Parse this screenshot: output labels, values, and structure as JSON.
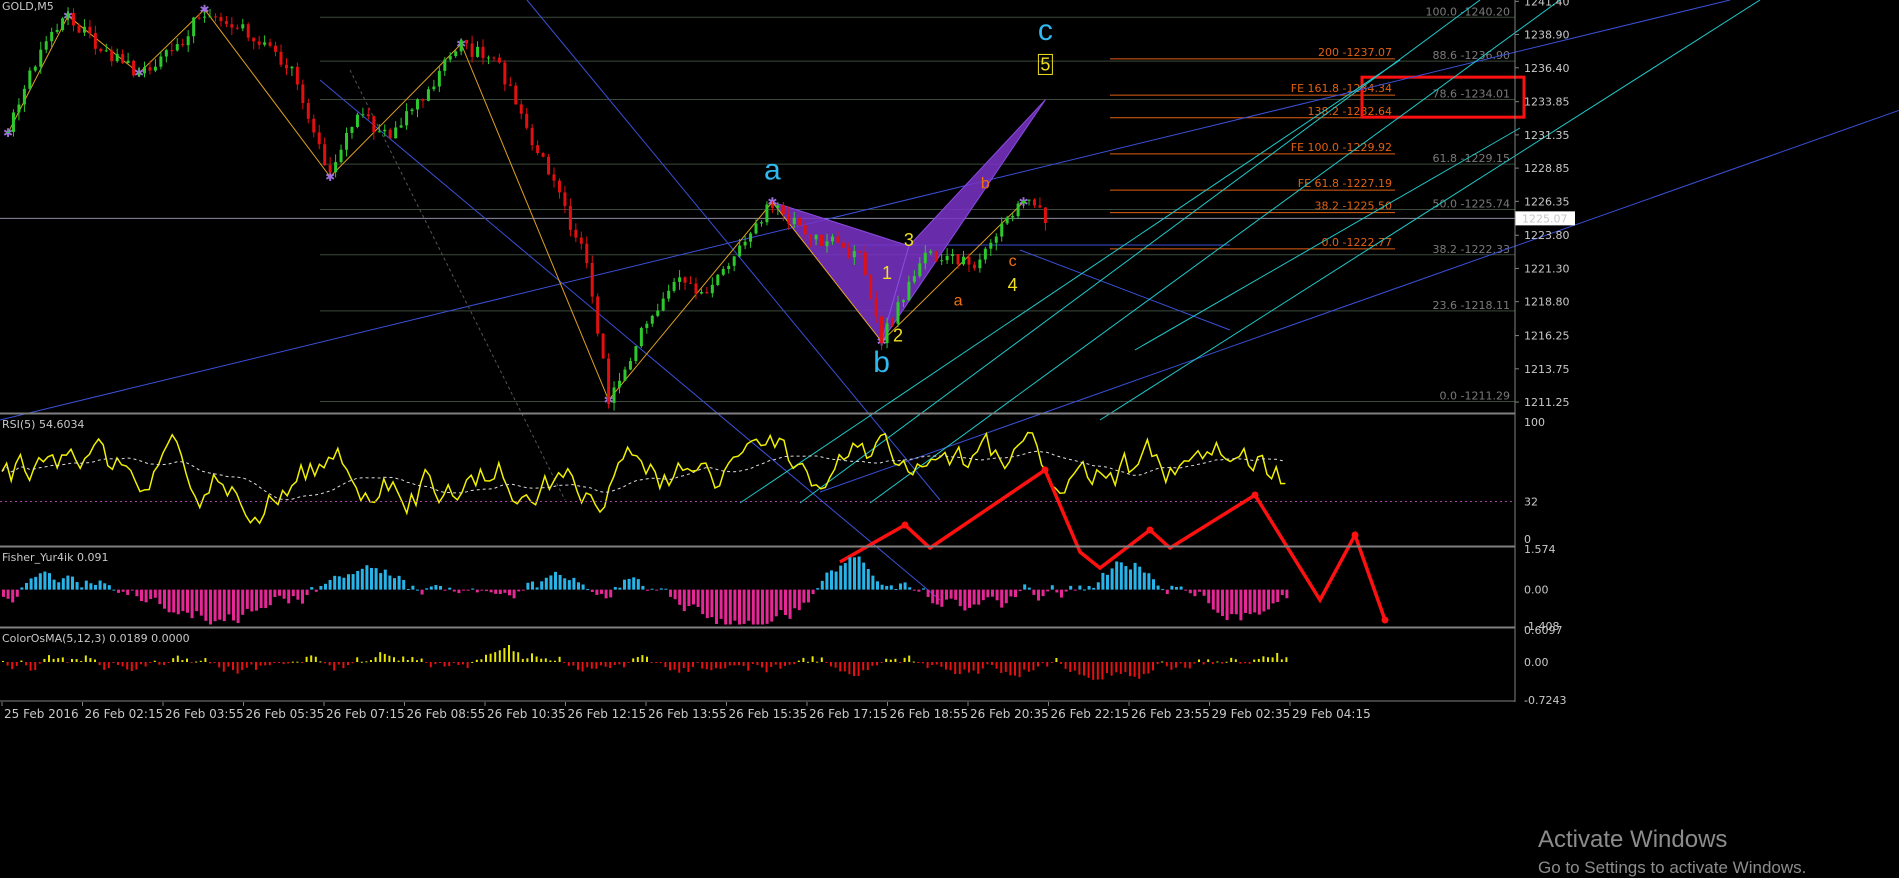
{
  "symbol": "GOLD,M5",
  "window_watermark": {
    "line1": "Activate Windows",
    "line2": "Go to Settings to activate Windows."
  },
  "colors": {
    "background": "#000000",
    "bull_candle": "#2dc82d",
    "bear_candle": "#e01010",
    "fib_gray": "#7a7a7a",
    "fib_orange": "#e06010",
    "channel_blue": "#3a50d8",
    "channel_cyan": "#20c8c8",
    "zigzag": "#e0a020",
    "harmonic_fill": "#7a32c8",
    "rsi_line": "#f0f000",
    "red_arrow": "#ff1010",
    "hist_up": "#28b4e8",
    "hist_down": "#e62896",
    "osma_up": "#e6e600",
    "osma_down": "#e61010",
    "wave_cyan": "#30b8f0",
    "wave_yellow": "#f0e020",
    "wave_orange": "#f07010"
  },
  "chart_data": [
    {
      "type": "candlestick",
      "title": "GOLD,M5",
      "ylim": [
        1210.5,
        1241.5
      ],
      "price_ticks": [
        "1241.40",
        "1238.90",
        "1236.40",
        "1233.85",
        "1231.35",
        "1228.85",
        "1226.35",
        "1223.80",
        "1221.30",
        "1218.80",
        "1216.25",
        "1213.75",
        "1211.25"
      ],
      "current_price": "1225.07",
      "time_ticks": [
        "25 Feb 2016",
        "26 Feb 02:15",
        "26 Feb 03:55",
        "26 Feb 05:35",
        "26 Feb 07:15",
        "26 Feb 08:55",
        "26 Feb 10:35",
        "26 Feb 12:15",
        "26 Feb 13:55",
        "26 Feb 15:35",
        "26 Feb 17:15",
        "26 Feb 18:55",
        "26 Feb 20:35",
        "26 Feb 22:15",
        "26 Feb 23:55",
        "29 Feb 02:35",
        "29 Feb 04:15"
      ],
      "price_path_keypoints": [
        [
          0,
          1231.5
        ],
        [
          5,
          1237.0
        ],
        [
          11,
          1240.3
        ],
        [
          18,
          1237.5
        ],
        [
          24,
          1236.0
        ],
        [
          30,
          1237.5
        ],
        [
          36,
          1240.8
        ],
        [
          45,
          1238.8
        ],
        [
          52,
          1236.5
        ],
        [
          59,
          1228.2
        ],
        [
          64,
          1233.0
        ],
        [
          70,
          1231.0
        ],
        [
          76,
          1234.3
        ],
        [
          83,
          1238.2
        ],
        [
          90,
          1236.5
        ],
        [
          96,
          1231.0
        ],
        [
          101,
          1226.5
        ],
        [
          106,
          1222.0
        ],
        [
          110,
          1211.4
        ],
        [
          116,
          1216.5
        ],
        [
          122,
          1220.5
        ],
        [
          128,
          1219.5
        ],
        [
          133,
          1222.0
        ],
        [
          140,
          1226.2
        ],
        [
          146,
          1224.0
        ],
        [
          152,
          1223.0
        ],
        [
          156,
          1222.0
        ],
        [
          160,
          1215.8
        ],
        [
          163,
          1218.5
        ],
        [
          167,
          1222.0
        ],
        [
          172,
          1222.5
        ],
        [
          177,
          1221.5
        ],
        [
          182,
          1224.5
        ],
        [
          186,
          1226.3
        ],
        [
          190,
          1225.1
        ]
      ],
      "fib_levels_gray": [
        {
          "label": "100.0 -1240.20",
          "price": 1240.2
        },
        {
          "label": "88.6 -1236.90",
          "price": 1236.9
        },
        {
          "label": "78.6 -1234.01",
          "price": 1234.01
        },
        {
          "label": "61.8 -1229.15",
          "price": 1229.15
        },
        {
          "label": "50.0 -1225.74",
          "price": 1225.74
        },
        {
          "label": "38.2 -1222.33",
          "price": 1222.33
        },
        {
          "label": "23.6 -1218.11",
          "price": 1218.11
        },
        {
          "label": "0.0 -1211.29",
          "price": 1211.29
        }
      ],
      "fib_levels_orange": [
        {
          "label": "200 -1237.07",
          "price": 1237.07
        },
        {
          "label": "FE 161.8 -1234.34",
          "price": 1234.34
        },
        {
          "label": "138.2 -1232.64",
          "price": 1232.64
        },
        {
          "label": "FE 100.0 -1229.92",
          "price": 1229.92
        },
        {
          "label": "FE 61.8 -1227.19",
          "price": 1227.19
        },
        {
          "label": "38.2 -1225.50",
          "price": 1225.5
        },
        {
          "label": "0.0 -1222.77",
          "price": 1222.77
        }
      ],
      "wave_labels": [
        {
          "text": "a",
          "color": "cyan",
          "x": 140,
          "price": 1228.0
        },
        {
          "text": "b",
          "color": "cyan",
          "x": 160,
          "price": 1213.5
        },
        {
          "text": "c",
          "color": "cyan",
          "x": 190,
          "price": 1238.5
        },
        {
          "text": "5",
          "color": "yellow",
          "x": 190,
          "price": 1236.2
        },
        {
          "text": "1",
          "color": "yellow",
          "x": 161,
          "price": 1220.5
        },
        {
          "text": "2",
          "color": "yellow",
          "x": 163,
          "price": 1215.8
        },
        {
          "text": "3",
          "color": "yellow",
          "x": 165,
          "price": 1223.0
        },
        {
          "text": "4",
          "color": "yellow",
          "x": 184,
          "price": 1219.6
        },
        {
          "text": "a",
          "color": "orange",
          "x": 174,
          "price": 1218.5
        },
        {
          "text": "b",
          "color": "orange",
          "x": 179,
          "price": 1227.3
        },
        {
          "text": "c",
          "color": "orange",
          "x": 184,
          "price": 1221.5
        }
      ]
    },
    {
      "type": "line",
      "title": "RSI(5) 54.6034",
      "ylim": [
        0,
        100
      ],
      "levels": [
        "100",
        "32",
        "0"
      ],
      "last_value": 54.6
    },
    {
      "type": "bar",
      "title": "Fisher_Yur4ik 0.091",
      "levels": [
        "1.574",
        "0.00",
        "-1.408"
      ],
      "ylim": [
        -1.408,
        1.574
      ],
      "last_value": 0.091
    },
    {
      "type": "bar",
      "title": "ColorOsMA(5,12,3) 0.0189 0.0000",
      "levels": [
        "0.6097",
        "0.00",
        "-0.7243"
      ],
      "ylim": [
        -0.7243,
        0.6097
      ],
      "last_value": 0.0189
    }
  ]
}
